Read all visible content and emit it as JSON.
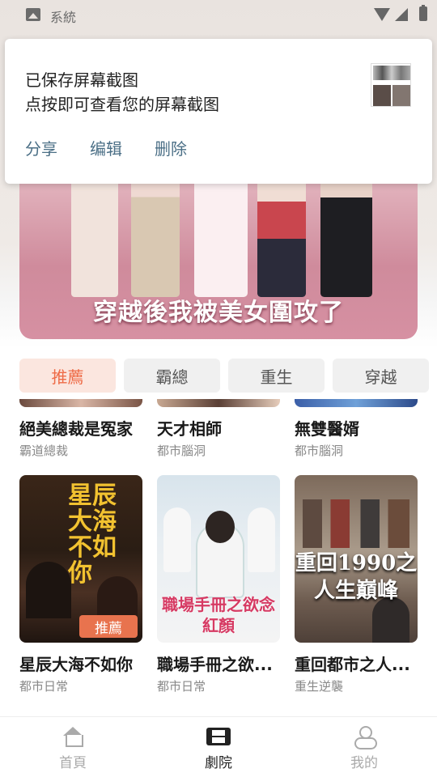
{
  "status_bar": {
    "title": "系統"
  },
  "banner": {
    "title": "穿越後我被美女圍攻了"
  },
  "notification": {
    "line1": "已保存屏幕截图",
    "line2": "点按即可查看您的屏幕截图",
    "actions": [
      "分享",
      "编辑",
      "删除"
    ]
  },
  "tabs": [
    {
      "label": "推薦",
      "active": true
    },
    {
      "label": "霸總",
      "active": false
    },
    {
      "label": "重生",
      "active": false
    },
    {
      "label": "穿越",
      "active": false
    }
  ],
  "row1": [
    {
      "title": "絕美總裁是冤家",
      "tag": "霸道總裁"
    },
    {
      "title": "天才相師",
      "tag": "都市腦洞"
    },
    {
      "title": "無雙醫婿",
      "tag": "都市腦洞"
    }
  ],
  "row2": [
    {
      "title": "星辰大海不如你",
      "tag": "都市日常",
      "poster_text": "星辰大海不如你",
      "badge": "推薦"
    },
    {
      "title": "職場手冊之欲...",
      "tag": "都市日常",
      "poster_text": "職場手冊之欲念紅顏"
    },
    {
      "title": "重回都市之人...",
      "tag": "重生逆襲",
      "poster_text": "重回1990之人生巔峰"
    }
  ],
  "bottom_nav": [
    {
      "label": "首頁",
      "icon": "home-icon",
      "active": false
    },
    {
      "label": "劇院",
      "icon": "film-icon",
      "active": true
    },
    {
      "label": "我的",
      "icon": "user-icon",
      "active": false
    }
  ],
  "colors": {
    "accent": "#ee6b47",
    "action_text": "#4b6f86",
    "badge": "#e8734e"
  }
}
